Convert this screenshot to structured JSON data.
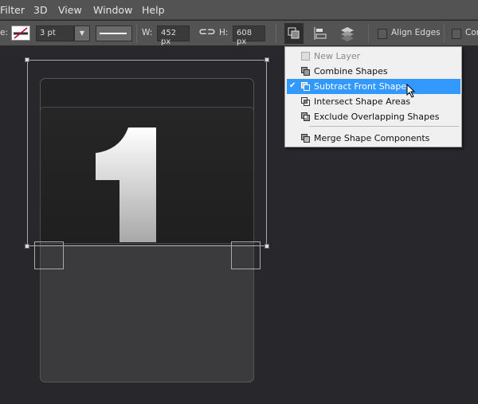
{
  "menubar": {
    "items": [
      "Filter",
      "3D",
      "View",
      "Window",
      "Help"
    ]
  },
  "toolbar": {
    "stroke_label": "e:",
    "stroke_width": "3 pt",
    "w_label": "W:",
    "w_value": "452 px",
    "h_label": "H:",
    "h_value": "608 px",
    "align_edges": "Align Edges",
    "constrain": "Con"
  },
  "menu": {
    "items": [
      {
        "label": "New Layer",
        "disabled": true
      },
      {
        "label": "Combine Shapes"
      },
      {
        "label": "Subtract Front Shape",
        "checked": true,
        "highlighted": true
      },
      {
        "label": "Intersect Shape Areas"
      },
      {
        "label": "Exclude Overlapping Shapes"
      },
      {
        "label": "Merge Shape Components"
      }
    ],
    "check": "✔"
  },
  "colors": {
    "highlight": "#3399ff",
    "canvas": "#28282c",
    "panel": "#535353"
  }
}
